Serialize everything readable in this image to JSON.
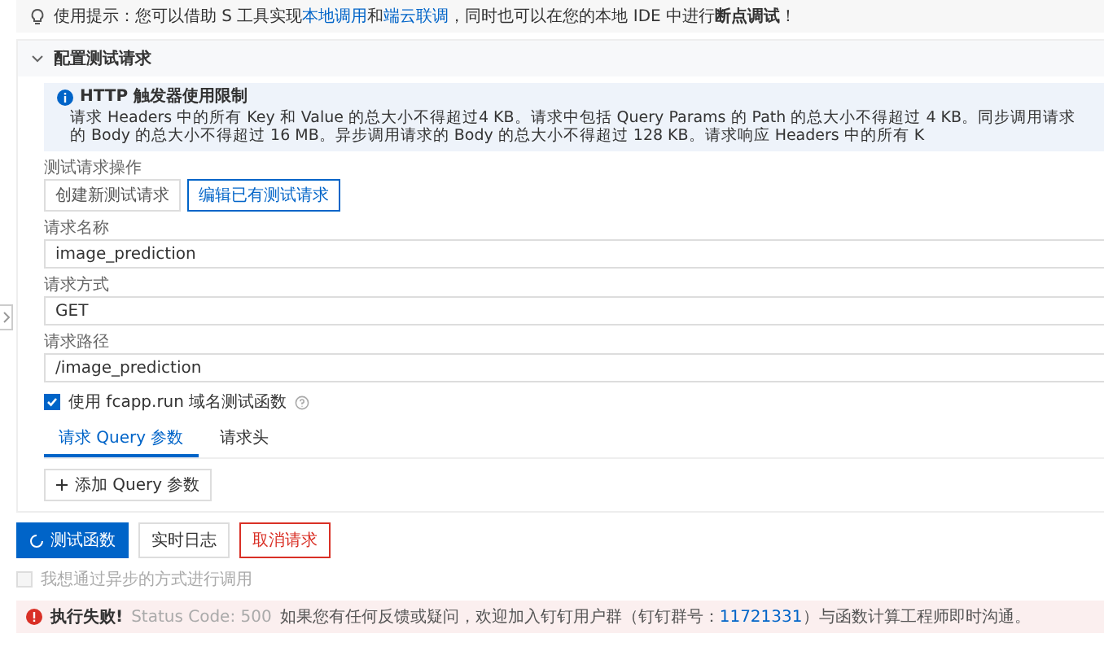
{
  "tip": {
    "parts": [
      {
        "kind": "text",
        "text": "使用提示：您可以借助 S 工具实现"
      },
      {
        "kind": "link",
        "text": "本地调用"
      },
      {
        "kind": "text",
        "text": "和"
      },
      {
        "kind": "link",
        "text": "端云联调"
      },
      {
        "kind": "text",
        "text": "，同时也可以在您的本地 IDE 中进行"
      },
      {
        "kind": "bold",
        "text": "断点调试"
      },
      {
        "kind": "text",
        "text": "！"
      }
    ]
  },
  "section": {
    "title": "配置测试请求",
    "expanded": true
  },
  "notice": {
    "title": "HTTP 触发器使用限制",
    "text": "请求 Headers 中的所有 Key 和 Value 的总大小不得超过4 KB。请求中包括 Query Params 的 Path 的总大小不得超过 4 KB。同步调用请求的 Body 的总大小不得超过 16 MB。异步调用请求的 Body 的总大小不得超过 128 KB。请求响应 Headers 中的所有 K"
  },
  "operation": {
    "label": "测试请求操作",
    "options": [
      {
        "label": "创建新测试请求",
        "selected": false
      },
      {
        "label": "编辑已有测试请求",
        "selected": true
      }
    ]
  },
  "fields": [
    {
      "label": "请求名称",
      "value": "image_prediction"
    },
    {
      "label": "请求方式",
      "value": "GET"
    },
    {
      "label": "请求路径",
      "value": "/image_prediction"
    }
  ],
  "domain_checkbox": {
    "label": "使用 fcapp.run 域名测试函数",
    "checked": true
  },
  "tabs": [
    {
      "label": "请求 Query 参数",
      "selected": true
    },
    {
      "label": "请求头",
      "selected": false
    }
  ],
  "add_button": "添加 Query 参数",
  "actions": [
    {
      "label": "测试函数",
      "kind": "primary",
      "loading": true
    },
    {
      "label": "实时日志",
      "kind": "normal",
      "loading": false
    },
    {
      "label": "取消请求",
      "kind": "danger",
      "loading": false
    }
  ],
  "async_checkbox": {
    "label": "我想通过异步的方式进行调用",
    "checked": false,
    "disabled": true
  },
  "error": {
    "title": "执行失败!",
    "status": "Status Code: 500",
    "parts": [
      {
        "kind": "text",
        "text": "如果您有任何反馈或疑问，欢迎加入钉钉用户群（钉钉群号："
      },
      {
        "kind": "link",
        "text": "11721331"
      },
      {
        "kind": "text",
        "text": "）与函数计算工程师即时沟通。"
      }
    ]
  }
}
